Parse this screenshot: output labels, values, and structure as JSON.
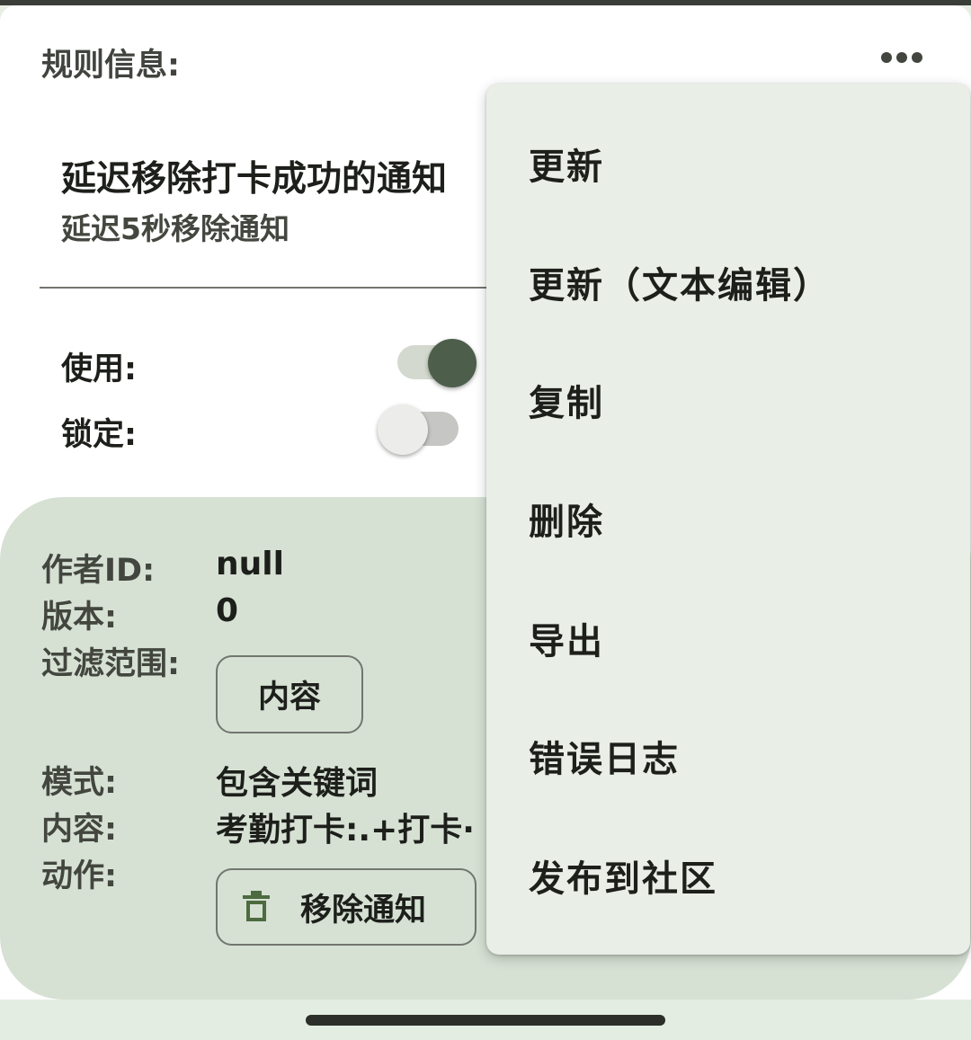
{
  "header": {
    "title": "规则信息:",
    "more_icon": "more-horizontal-icon"
  },
  "rule": {
    "title": "延迟移除打卡成功的通知",
    "subtitle": "延迟5秒移除通知"
  },
  "settings": [
    {
      "label": "使用:",
      "enabled": true
    },
    {
      "label": "锁定:",
      "enabled": false
    }
  ],
  "details": {
    "author_label": "作者ID:",
    "author_value": "null",
    "version_label": "版本:",
    "version_value": "0",
    "filter_scope_label": "过滤范围:",
    "filter_scope_value": "内容",
    "mode_label": "模式:",
    "mode_value": "包含关键词",
    "content_label": "内容:",
    "content_value": "考勤打卡:.+打卡·",
    "action_label": "动作:",
    "action_value": "移除通知",
    "action_icon": "trash-icon"
  },
  "menu": {
    "items": [
      {
        "label": "更新"
      },
      {
        "label": "更新（文本编辑）"
      },
      {
        "label": "复制"
      },
      {
        "label": "删除"
      },
      {
        "label": "导出"
      },
      {
        "label": "错误日志"
      },
      {
        "label": "发布到社区"
      }
    ]
  },
  "colors": {
    "accent": "#4d5f4b",
    "card_background": "#d6e1d4",
    "menu_background": "#e9eee6",
    "text_primary": "#1d1f1b",
    "text_secondary": "#43463f"
  }
}
